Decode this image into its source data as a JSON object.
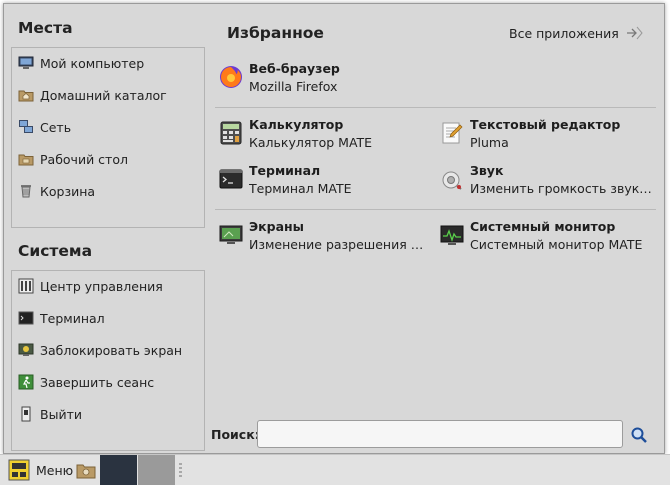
{
  "places": {
    "title": "Места",
    "items": [
      {
        "label": "Мой компьютер",
        "icon": "computer-icon"
      },
      {
        "label": "Домашний каталог",
        "icon": "home-folder-icon"
      },
      {
        "label": "Сеть",
        "icon": "network-icon"
      },
      {
        "label": "Рабочий стол",
        "icon": "desktop-folder-icon"
      },
      {
        "label": "Корзина",
        "icon": "trash-icon"
      }
    ]
  },
  "system": {
    "title": "Система",
    "items": [
      {
        "label": "Центр управления",
        "icon": "control-center-icon"
      },
      {
        "label": "Терминал",
        "icon": "terminal-icon"
      },
      {
        "label": "Заблокировать экран",
        "icon": "lock-screen-icon"
      },
      {
        "label": "Завершить сеанс",
        "icon": "logout-icon"
      },
      {
        "label": "Выйти",
        "icon": "shutdown-icon"
      }
    ]
  },
  "favorites": {
    "title": "Избранное",
    "all_apps_label": "Все приложения",
    "apps": [
      {
        "name": "Веб-браузер",
        "desc": "Mozilla Firefox",
        "icon": "firefox-icon"
      },
      {
        "name": "Калькулятор",
        "desc": "Калькулятор MATE",
        "icon": "calculator-icon"
      },
      {
        "name": "Текстовый редактор",
        "desc": "Pluma",
        "icon": "text-editor-icon"
      },
      {
        "name": "Терминал",
        "desc": "Терминал MATE",
        "icon": "terminal-icon"
      },
      {
        "name": "Звук",
        "desc": "Изменить громкость звука и …",
        "icon": "sound-icon"
      },
      {
        "name": "Экраны",
        "desc": "Изменение разрешения и п…",
        "icon": "display-icon"
      },
      {
        "name": "Системный монитор",
        "desc": "Системный монитор MATE",
        "icon": "system-monitor-icon"
      }
    ]
  },
  "search": {
    "label": "Поиск:",
    "value": "",
    "placeholder": ""
  },
  "taskbar": {
    "menu_label": "Меню"
  },
  "colors": {
    "window_bg": "#d8d8d8",
    "taskbar_bg": "#e2e2e2",
    "workspace_active": "#2a3340",
    "workspace_inactive": "#9a9a9a"
  }
}
